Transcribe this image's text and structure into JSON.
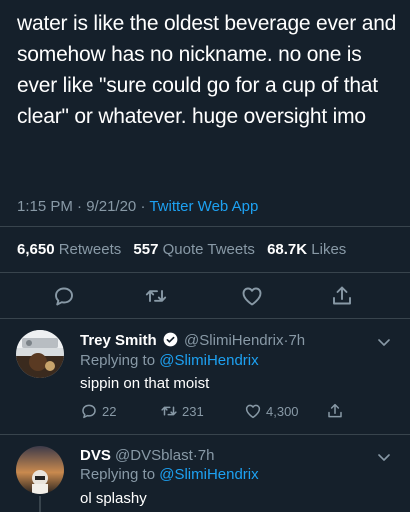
{
  "tweet": {
    "text": "water is like the oldest beverage ever and somehow has no nickname. no one is ever like \"sure could go for a cup of that clear\" or whatever. huge oversight imo",
    "time": "1:15 PM",
    "date": "9/21/20",
    "source": "Twitter Web App"
  },
  "stats": {
    "retweets_count": "6,650",
    "retweets_label": "Retweets",
    "quotes_count": "557",
    "quotes_label": "Quote Tweets",
    "likes_count": "68.7K",
    "likes_label": "Likes"
  },
  "replies": [
    {
      "name": "Trey Smith",
      "handle": "@SlimiHendrix",
      "time": "7h",
      "replying_label": "Replying to",
      "replying_handle": "@SlimiHendrix",
      "text": "sippin on that moist",
      "reply_count": "22",
      "retweet_count": "231",
      "like_count": "4,300",
      "verified": true
    },
    {
      "name": "DVS",
      "handle": "@DVSblast",
      "time": "7h",
      "replying_label": "Replying to",
      "replying_handle": "@SlimiHendrix",
      "text": "ol splashy"
    }
  ],
  "separator": "·",
  "colors": {
    "background": "#15202b",
    "secondary_text": "#8899a6",
    "accent": "#1da1f2",
    "divider": "#38444d"
  }
}
